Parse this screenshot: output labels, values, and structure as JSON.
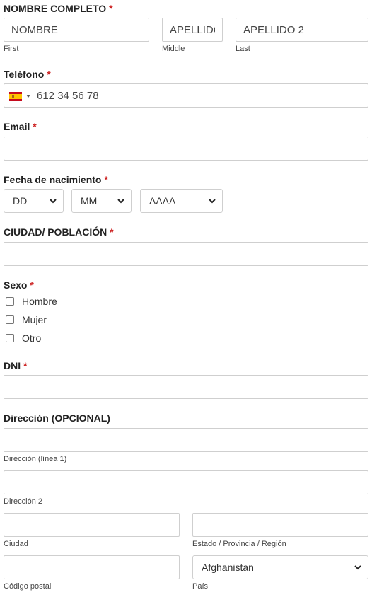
{
  "required_mark": "*",
  "full_name": {
    "label": "NOMBRE COMPLETO",
    "first": {
      "placeholder": "NOMBRE",
      "sublabel": "First"
    },
    "middle": {
      "placeholder": "APELLIDO",
      "sublabel": "Middle"
    },
    "last": {
      "placeholder": "APELLIDO 2",
      "sublabel": "Last"
    }
  },
  "phone": {
    "label": "Teléfono",
    "country_flag": "spain-flag-icon",
    "placeholder": "612 34 56 78"
  },
  "email": {
    "label": "Email",
    "value": ""
  },
  "birth_date": {
    "label": "Fecha de nacimiento",
    "day": "DD",
    "month": "MM",
    "year": "AAAA"
  },
  "city_town": {
    "label": "CIUDAD/ POBLACIÓN",
    "value": ""
  },
  "sex": {
    "label": "Sexo",
    "options": [
      "Hombre",
      "Mujer",
      "Otro"
    ]
  },
  "dni": {
    "label": "DNI",
    "value": ""
  },
  "address": {
    "label": "Dirección (OPCIONAL)",
    "line1_sublabel": "Dirección (línea 1)",
    "line2_sublabel": "Dirección 2",
    "city_sublabel": "Ciudad",
    "state_sublabel": "Estado / Provincia / Región",
    "zip_sublabel": "Código postal",
    "country_sublabel": "País",
    "country_value": "Afghanistan"
  },
  "colors": {
    "required": "#cc1f1f",
    "border": "#cfcfcf",
    "text": "#222222"
  }
}
